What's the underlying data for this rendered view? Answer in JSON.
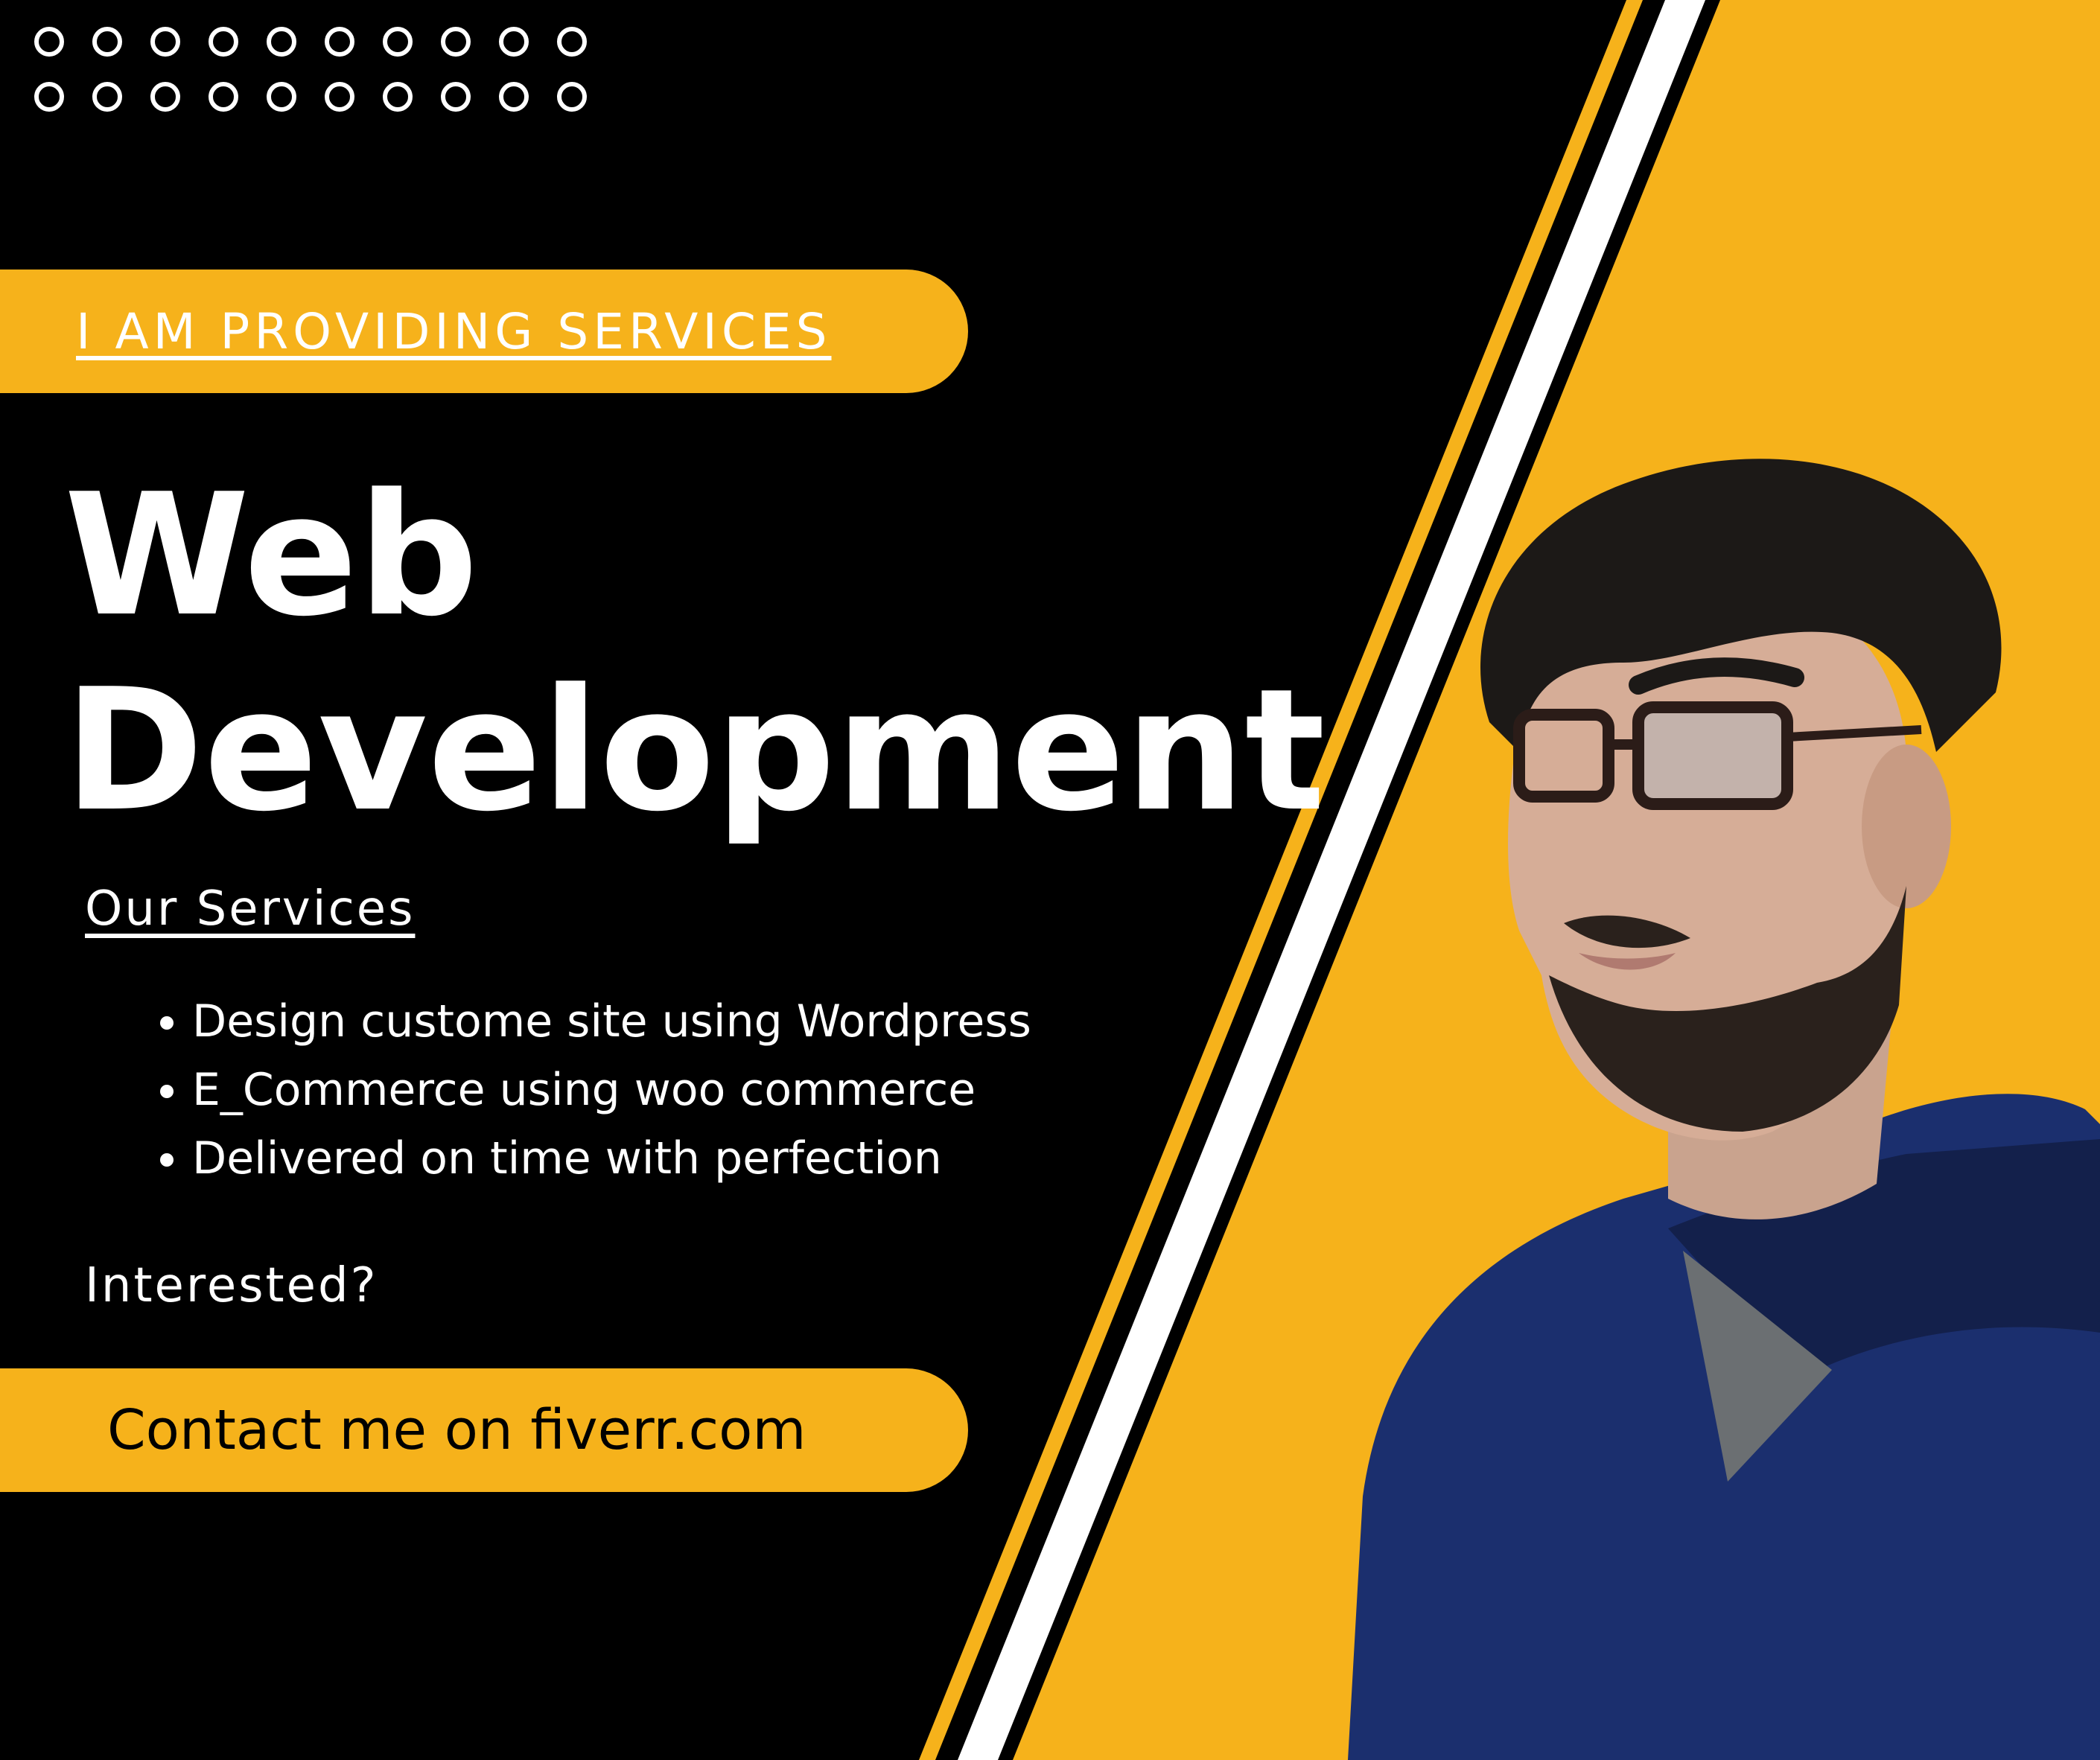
{
  "banner": {
    "tagline": "I AM PROVIDING SERVICES",
    "headline_line1": "Web",
    "headline_line2": "Development",
    "services_title": "Our Services",
    "services": [
      "Design custome site using Wordpress",
      "E_Commerce using woo commerce",
      "Delivered on time with perfection"
    ],
    "prompt": "Interested?",
    "cta": "Contact me on fiverr.com"
  },
  "colors": {
    "background": "#000000",
    "accent": "#f6b21b",
    "text": "#ffffff"
  },
  "icons": [
    "circle-pattern-icon",
    "dot-grid-icon",
    "bullet-icon"
  ]
}
